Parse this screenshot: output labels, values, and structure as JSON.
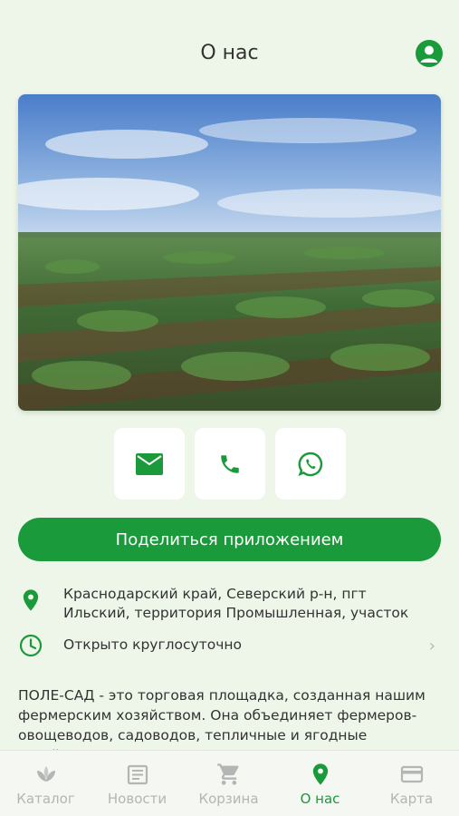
{
  "header": {
    "title": "О нас",
    "profile_icon": "account-circle-icon"
  },
  "photo": {
    "subject": "field-photo"
  },
  "contacts": [
    {
      "icon": "mail-icon"
    },
    {
      "icon": "phone-icon"
    },
    {
      "icon": "whatsapp-icon"
    }
  ],
  "share_button": {
    "label": "Поделиться приложением"
  },
  "address": {
    "line1": "Краснодарский край, Северский р-н, пгт",
    "line2": "Ильский, территория Промышленная, участок"
  },
  "hours": {
    "text": "Открыто круглосуточно"
  },
  "description": {
    "text": "ПОЛЕ-САД    -  это торговая площадка, созданная нашим фермерским хозяйством. Она объединяет фермеров-овощеводов, садоводов, тепличные и ягодные хозяйства, пчеловодов и"
  },
  "tabbar": {
    "tabs": [
      {
        "label": "Каталог",
        "icon": "sprout-icon",
        "active": false
      },
      {
        "label": "Новости",
        "icon": "newspaper-icon",
        "active": false
      },
      {
        "label": "Корзина",
        "icon": "cart-icon",
        "active": false
      },
      {
        "label": "О нас",
        "icon": "map-pin-icon",
        "active": true
      },
      {
        "label": "Карта",
        "icon": "credit-card-icon",
        "active": false
      }
    ]
  },
  "colors": {
    "accent": "#1a9a3a",
    "background": "#eef6e9",
    "inactive": "#b5b5b5"
  }
}
